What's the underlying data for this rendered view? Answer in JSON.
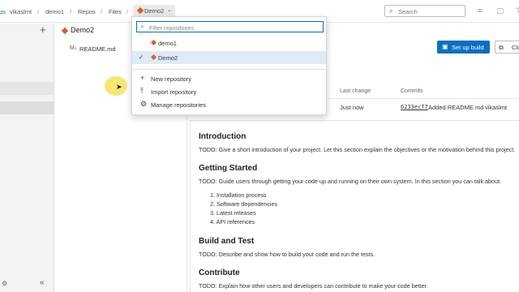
{
  "breadcrumb": {
    "org_fragment": "ps",
    "user": "vikaslmt",
    "project": "demo1",
    "repos": "Repos",
    "files": "Files",
    "current_repo": "Demo2"
  },
  "search": {
    "placeholder": "Search"
  },
  "dropdown": {
    "filter_placeholder": "Filter repositories",
    "repos": [
      {
        "name": "demo1",
        "selected": false
      },
      {
        "name": "Demo2",
        "selected": true
      }
    ],
    "actions": [
      {
        "label": "New repository",
        "icon": "plus-icon"
      },
      {
        "label": "Import repository",
        "icon": "import-icon"
      },
      {
        "label": "Manage repositories",
        "icon": "gear-icon"
      }
    ]
  },
  "tree": {
    "repo_name": "Demo2",
    "file_icon_text": "M↓",
    "file_name": "README.md"
  },
  "toolbar": {
    "setup_build": "Set up build",
    "clone": "Clo"
  },
  "file_table": {
    "headers": {
      "last_change": "Last change",
      "commits": "Commits"
    },
    "row": {
      "last_change": "Just now",
      "commit_hash": "6233ecf7",
      "commit_message": "Added README.md",
      "author": "vikaslmt"
    }
  },
  "readme": {
    "intro_heading": "Introduction",
    "intro_text": "TODO: Give a short introduction of your project. Let this section explain the objectives or the motivation behind this project.",
    "getting_started_heading": "Getting Started",
    "getting_started_text": "TODO: Guide users through getting your code up and running on their own system. In this section you can talk about:",
    "steps": [
      "1. Installation process",
      "2. Software dependencies",
      "3. Latest releases",
      "4. API references"
    ],
    "build_heading": "Build and Test",
    "build_text": "TODO: Describe and show how to build your code and run the tests.",
    "contribute_heading": "Contribute",
    "contribute_text": "TODO: Explain how other users and developers can contribute to make your code better."
  },
  "colors": {
    "accent": "#0a6fc2",
    "repo_icon": "#e05a2b",
    "selected_row": "#deebf7",
    "cursor_highlight": "#f4e25a"
  }
}
